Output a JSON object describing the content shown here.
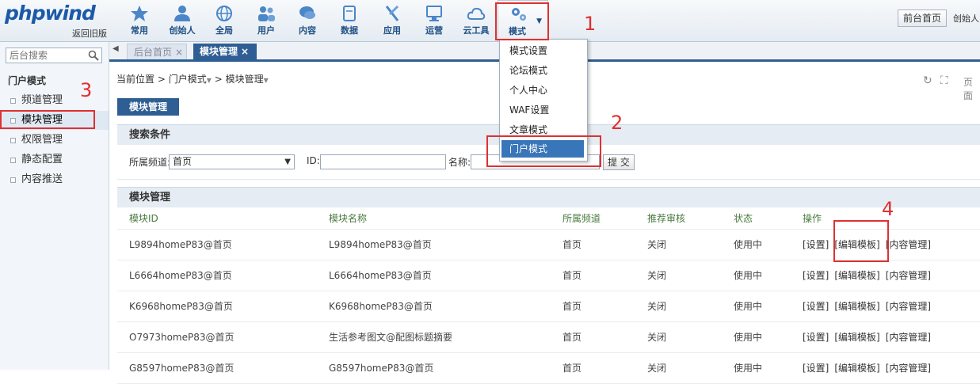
{
  "header": {
    "logo_text": "phpwind",
    "logo_sub": "返回旧版",
    "nav": [
      {
        "label": "常用",
        "icon": "star-icon"
      },
      {
        "label": "创始人",
        "icon": "person-icon"
      },
      {
        "label": "全局",
        "icon": "globe-icon"
      },
      {
        "label": "用户",
        "icon": "users-icon"
      },
      {
        "label": "内容",
        "icon": "chat-bubble-icon"
      },
      {
        "label": "数据",
        "icon": "database-icon"
      },
      {
        "label": "应用",
        "icon": "tools-icon"
      },
      {
        "label": "运营",
        "icon": "monitor-icon"
      },
      {
        "label": "云工具",
        "icon": "cloud-icon"
      },
      {
        "label": "模式",
        "icon": "gears-icon"
      }
    ],
    "front_btn": "前台首页",
    "founder": "创始人"
  },
  "mode_menu": {
    "items": [
      "模式设置",
      "论坛模式",
      "个人中心",
      "WAF设置",
      "文章模式",
      "门户模式"
    ],
    "highlighted": "门户模式"
  },
  "sidebar": {
    "search_placeholder": "后台搜索",
    "section_title": "门户模式",
    "items": [
      "频道管理",
      "模块管理",
      "权限管理",
      "静态配置",
      "内容推送"
    ],
    "active": "模块管理"
  },
  "tabs": {
    "home": "后台首页",
    "home_close": "×",
    "module": "模块管理",
    "module_close": "×"
  },
  "breadcrumb": {
    "current_label": "当前位置",
    "level1": "门户模式",
    "level2": "模块管理"
  },
  "page_label": "页面",
  "module_button": "模块管理",
  "search": {
    "title": "搜索条件",
    "channel_label": "所属频道:",
    "channel_value": "首页",
    "id_label": "ID:",
    "name_label": "名称:",
    "submit": "提 交"
  },
  "list": {
    "title": "模块管理",
    "columns": [
      "模块ID",
      "模块名称",
      "所属频道",
      "推荐审核",
      "状态",
      "操作"
    ],
    "rows": [
      [
        "L9894homeP83@首页",
        "L9894homeP83@首页",
        "首页",
        "关闭",
        "使用中"
      ],
      [
        "L6664homeP83@首页",
        "L6664homeP83@首页",
        "首页",
        "关闭",
        "使用中"
      ],
      [
        "K6968homeP83@首页",
        "K6968homeP83@首页",
        "首页",
        "关闭",
        "使用中"
      ],
      [
        "O7973homeP83@首页",
        "生活参考图文@配图标题摘要",
        "首页",
        "关闭",
        "使用中"
      ],
      [
        "G8597homeP83@首页",
        "G8597homeP83@首页",
        "首页",
        "关闭",
        "使用中"
      ]
    ],
    "ops": [
      "[设置]",
      "[编辑模板]",
      "[内容管理]"
    ]
  },
  "annotations": [
    "1",
    "2",
    "3",
    "4"
  ],
  "colors": {
    "brand_blue": "#2e5e93",
    "annotation_red": "#e03030",
    "menu_highlight": "#3976b9"
  }
}
